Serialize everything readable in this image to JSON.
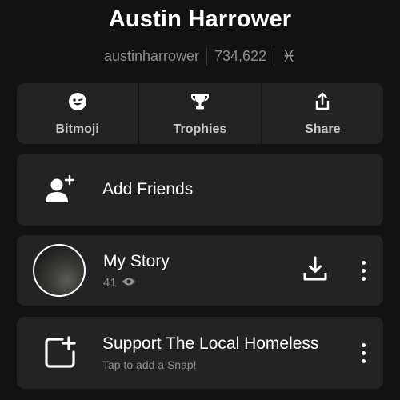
{
  "profile": {
    "display_name": "Austin Harrower",
    "username": "austinharrower",
    "score": "734,622",
    "zodiac_symbol": "♓"
  },
  "actions": [
    {
      "label": "Bitmoji",
      "icon": "bitmoji-face-icon"
    },
    {
      "label": "Trophies",
      "icon": "trophy-icon"
    },
    {
      "label": "Share",
      "icon": "share-icon"
    }
  ],
  "add_friends": {
    "label": "Add Friends",
    "icon": "add-friend-icon"
  },
  "my_story": {
    "title": "My Story",
    "views": "41",
    "view_icon": "eye-icon",
    "download_icon": "download-icon",
    "more_icon": "more-vertical-icon"
  },
  "custom_story": {
    "title": "Support The Local Homeless",
    "hint": "Tap to add a Snap!",
    "icon": "add-snap-icon",
    "more_icon": "more-vertical-icon"
  }
}
